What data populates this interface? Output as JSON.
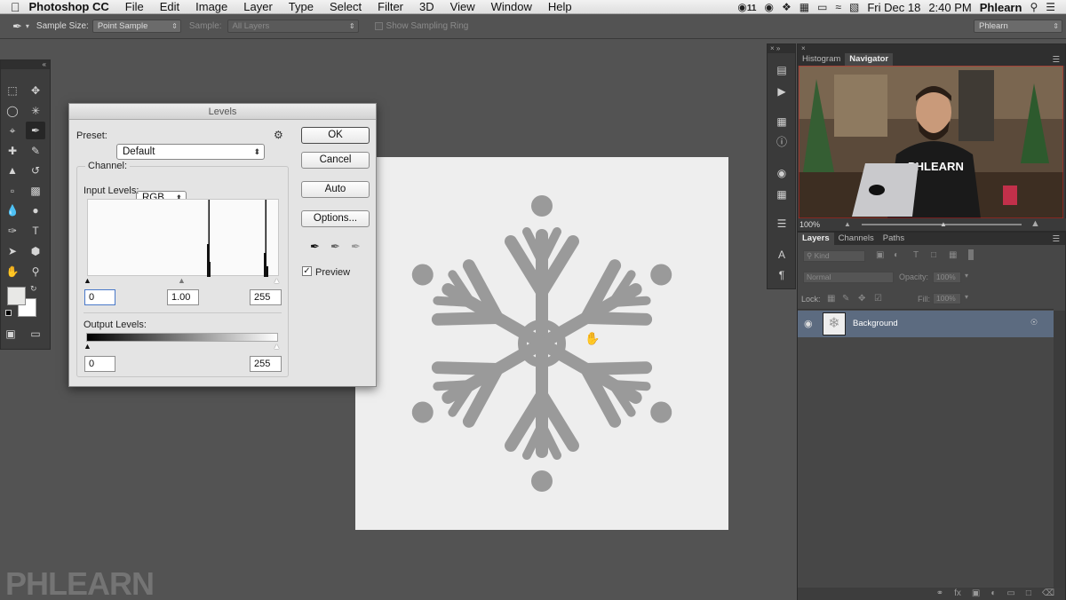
{
  "menubar": {
    "apple": "",
    "app": "Photoshop CC",
    "items": [
      "File",
      "Edit",
      "Image",
      "Layer",
      "Type",
      "Select",
      "Filter",
      "3D",
      "View",
      "Window",
      "Help"
    ],
    "status": {
      "cc_count": "11",
      "date": "Fri Dec 18",
      "time": "2:40 PM",
      "user": "Phlearn"
    }
  },
  "optbar": {
    "sample_size_label": "Sample Size:",
    "sample_size_value": "Point Sample",
    "sample_label": "Sample:",
    "sample_value": "All Layers",
    "ring_label": "Show Sampling Ring",
    "workspace": "Phlearn"
  },
  "levels": {
    "title": "Levels",
    "preset_label": "Preset:",
    "preset_value": "Default",
    "channel_label": "Channel:",
    "channel_value": "RGB",
    "input_label": "Input Levels:",
    "input_black": "0",
    "input_gamma": "1.00",
    "input_white": "255",
    "output_label": "Output Levels:",
    "output_black": "0",
    "output_white": "255",
    "buttons": {
      "ok": "OK",
      "cancel": "Cancel",
      "auto": "Auto",
      "options": "Options..."
    },
    "preview_label": "Preview",
    "preview_checked": true
  },
  "navigator": {
    "tabs": [
      "Histogram",
      "Navigator"
    ],
    "active": "Navigator",
    "zoom": "100%",
    "shirt_text": "PHLEARN"
  },
  "layers": {
    "tabs": [
      "Layers",
      "Channels",
      "Paths"
    ],
    "active": "Layers",
    "kind_label": "Kind",
    "blend_mode": "Normal",
    "opacity_label": "Opacity:",
    "opacity_value": "100%",
    "lock_label": "Lock:",
    "fill_label": "Fill:",
    "fill_value": "100%",
    "items": [
      {
        "name": "Background",
        "locked": true,
        "visible": true,
        "selected": true
      }
    ]
  },
  "watermark": "PHLEARN",
  "colors": {
    "snowflake": "#9a9a9a",
    "canvas": "#eeeeee",
    "ps_bg": "#535353",
    "layer_selected": "#5c6b80"
  }
}
